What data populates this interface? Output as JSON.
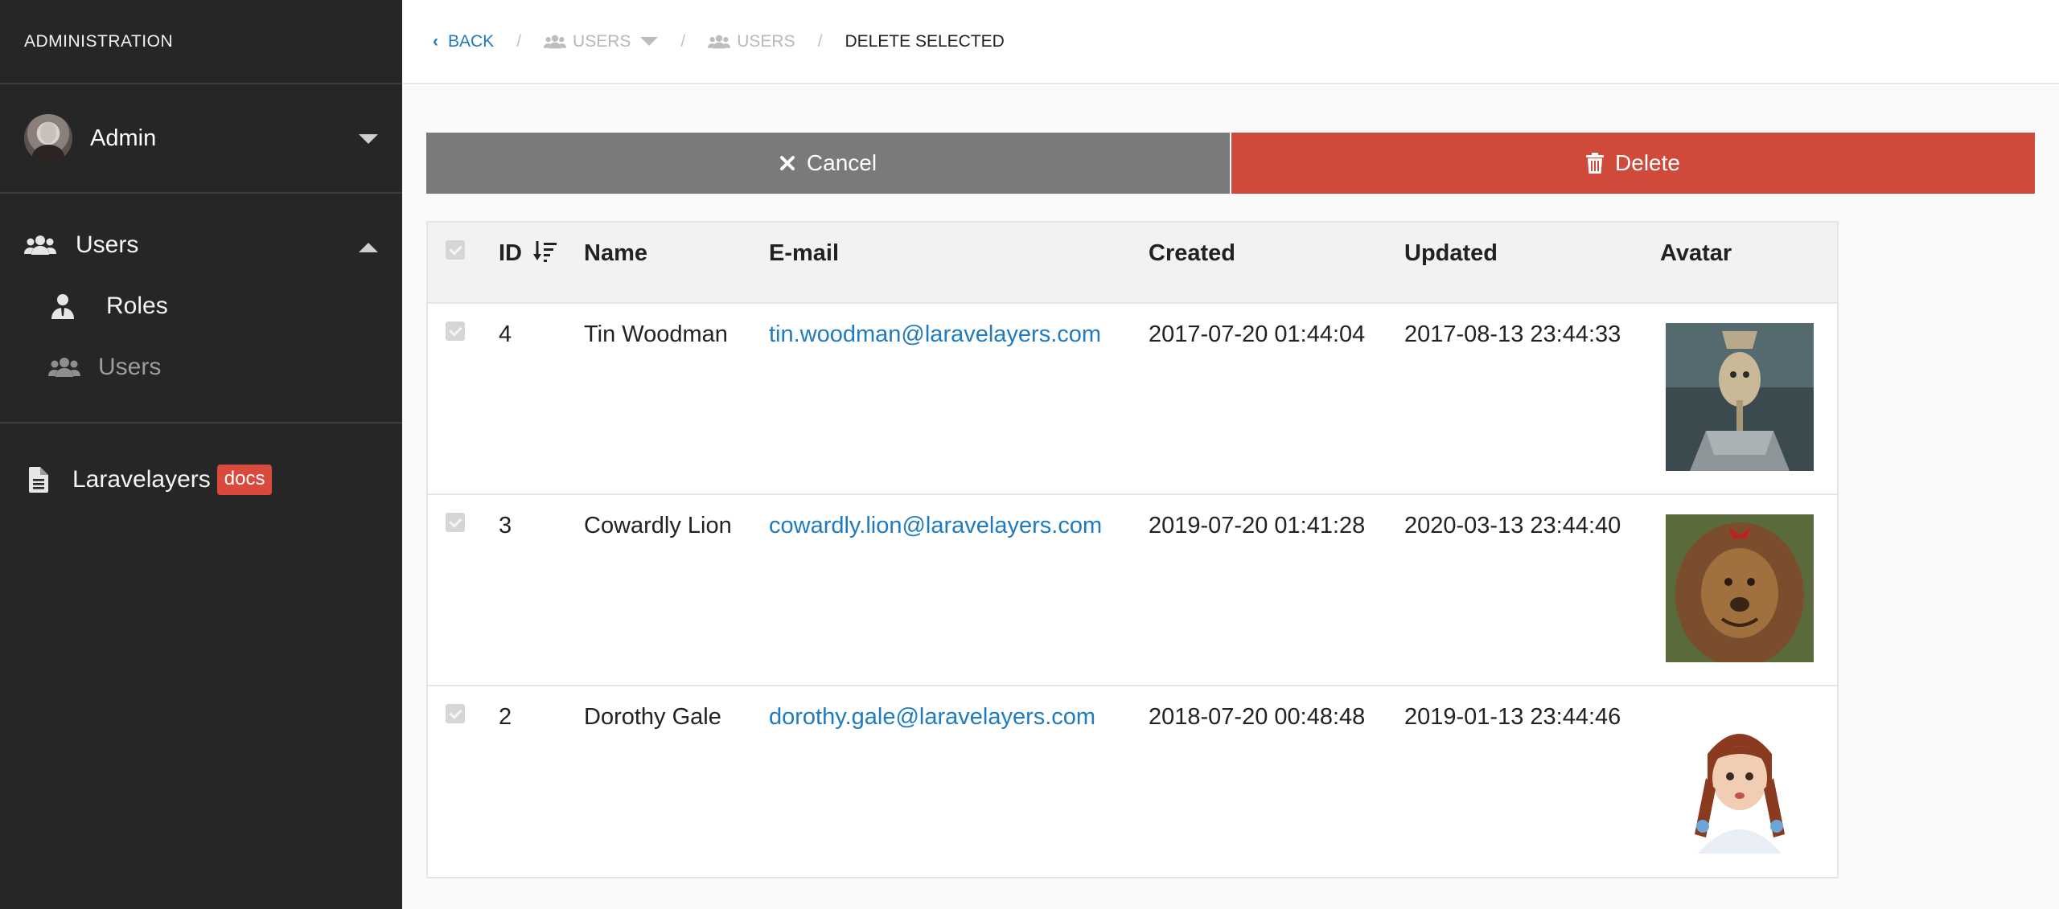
{
  "sidebar": {
    "brand": "ADMINISTRATION",
    "user": {
      "name": "Admin"
    },
    "nav": [
      {
        "label": "Users",
        "icon": "users-icon"
      },
      {
        "label": "Roles",
        "icon": "user-tie-icon"
      },
      {
        "label": "Users",
        "icon": "users-icon"
      }
    ],
    "docs": {
      "label": "Laravelayers",
      "badge": "docs",
      "icon": "file-icon"
    }
  },
  "breadcrumb": {
    "back": "BACK",
    "items": [
      "USERS",
      "USERS"
    ],
    "current": "DELETE SELECTED"
  },
  "actions": {
    "cancel": "Cancel",
    "delete": "Delete"
  },
  "table": {
    "columns": [
      "ID",
      "Name",
      "E-mail",
      "Created",
      "Updated",
      "Avatar"
    ],
    "rows": [
      {
        "id": "4",
        "name": "Tin Woodman",
        "email": "tin.woodman@laravelayers.com",
        "created": "2017-07-20 01:44:04",
        "updated": "2017-08-13 23:44:33"
      },
      {
        "id": "3",
        "name": "Cowardly Lion",
        "email": "cowardly.lion@laravelayers.com",
        "created": "2019-07-20 01:41:28",
        "updated": "2020-03-13 23:44:40"
      },
      {
        "id": "2",
        "name": "Dorothy Gale",
        "email": "dorothy.gale@laravelayers.com",
        "created": "2018-07-20 00:48:48",
        "updated": "2019-01-13 23:44:46"
      }
    ]
  },
  "colors": {
    "sidebar_bg": "#262626",
    "link": "#1f7bc1",
    "cancel_bg": "#7a7a7a",
    "delete_bg": "#cf4a3b",
    "badge_bg": "#d9493c"
  }
}
